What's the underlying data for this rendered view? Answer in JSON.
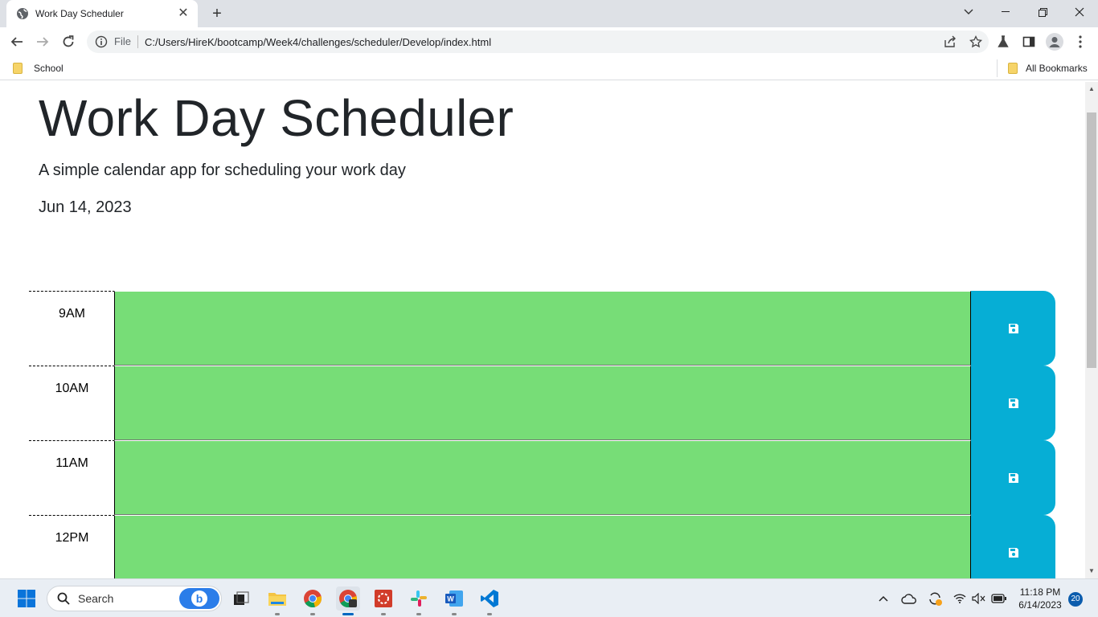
{
  "browser": {
    "tab_title": "Work Day Scheduler",
    "scheme": "File",
    "url": "C:/Users/HireK/bootcamp/Week4/challenges/scheduler/Develop/index.html",
    "bookmarks": [
      {
        "label": "School"
      }
    ],
    "all_bookmarks_label": "All Bookmarks"
  },
  "page": {
    "title": "Work Day Scheduler",
    "lead": "A simple calendar app for scheduling your work day",
    "current_day": "Jun 14, 2023"
  },
  "timeblocks": [
    {
      "hour": "9AM",
      "status": "present"
    },
    {
      "hour": "10AM",
      "status": "present"
    },
    {
      "hour": "11AM",
      "status": "present"
    },
    {
      "hour": "12PM",
      "status": "present"
    }
  ],
  "colors": {
    "block": "#77dd77",
    "save_button": "#06aed5"
  },
  "taskbar": {
    "search_label": "Search",
    "time": "11:18 PM",
    "date": "6/14/2023",
    "notification_count": "20"
  }
}
